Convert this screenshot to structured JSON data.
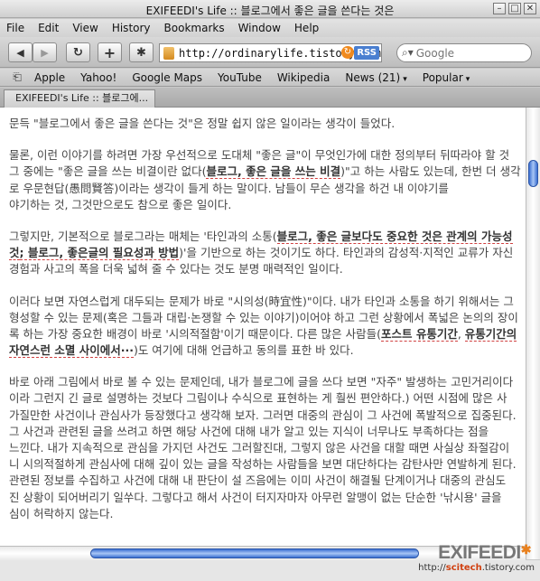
{
  "window": {
    "title": "EXIFEEDI's Life :: 블로그에서 좋은 글을 쓴다는 것은",
    "controls": [
      "–",
      "□",
      "✕"
    ]
  },
  "menu": [
    "File",
    "Edit",
    "View",
    "History",
    "Bookmarks",
    "Window",
    "Help"
  ],
  "toolbar": {
    "back_icon": "◀",
    "forward_icon": "▶",
    "reload_icon": "↻",
    "add_icon": "+",
    "bug_icon": "✱",
    "url": "http://ordinarylife.tistory.com",
    "rss_label": "RSS",
    "search_placeholder": "Google"
  },
  "bookmarks": {
    "book_icon": "⎗",
    "items": [
      "Apple",
      "Yahoo!",
      "Google Maps",
      "YouTube",
      "Wikipedia",
      "News (21)",
      "Popular"
    ],
    "chevron": "▾"
  },
  "tab": {
    "label": "EXIFEEDI's Life :: 블로그에..."
  },
  "article": {
    "p1": [
      "문득 \"블로그에서 좋은 글을 쓴다는 것\"은 정말 쉽지 않은 일이라는 생각이 들었다."
    ],
    "p2_l1": "물론, 이런 이야기를 하려면 가장 우선적으로 도대체 \"좋은 글\"이 무엇인가에 대한 정의부터 뒤따라야 할 것",
    "p2_l2a": "그 중에는 \"좋은 글을 쓰는 비결이란 없다(",
    "p2_l2u": "블로그, 좋은 글을 쓰는 비결",
    "p2_l2b": ")\"고 하는 사람도 있는데, 한번 더 생각",
    "p2_l3": "로 우문현답(愚問賢答)이라는 생각이 들게 하는 말이다. 남들이 무슨 생각을 하건 내 이야기를",
    "p2_l4": "야기하는 것, 그것만으로도 참으로 좋은 일이다.",
    "p3_l1a": "그렇지만, 기본적으로 블로그라는 매체는 '타인과의 소통(",
    "p3_l1u": "블로그, 좋은 글보다도 중요한 것은 관계의 가능성",
    "p3_l2a": "것",
    "p3_l2u": "; 블로그, 좋은글의 필요성과 방법",
    "p3_l2b": ")'을 기반으로 하는 것이기도 하다. 타인과의 감성적·지적인 교류가 자신",
    "p3_l3": "경험과 사고의 폭을 더욱 넓혀 줄 수 있다는 것도 분명 매력적인 일이다.",
    "p4_l1": "이러다 보면 자연스럽게 대두되는 문제가 바로 \"시의성(時宜性)\"이다. 내가 타인과 소통을 하기 위해서는 그",
    "p4_l2": "형성할 수 있는 문제(혹은 그들과 대립·논쟁할 수 있는 이야기)이어야 하고 그런 상황에서 폭넓은 논의의 장이",
    "p4_l3a": "록 하는 가장 중요한 배경이 바로 '시의적절함'이기 때문이다. 다른 많은 사람들(",
    "p4_l3u1": "포스트 유통기간",
    "p4_l3b": ", ",
    "p4_l3u2": "유통기간의",
    "p4_l4u": "자연스런 소멸 사이에서···",
    "p4_l4b": ")도 여기에 대해 언급하고 동의를 표한 바 있다.",
    "p5": [
      "바로 아래 그림에서 바로 볼 수 있는 문제인데, 내가 블로그에 글을 쓰다 보면 \"자주\" 발생하는 고민거리이다",
      "이라 그런지 긴 글로 설명하는 것보다 그림이나 수식으로 표현하는 게 훨씬 편안하다.) 어떤 시점에 많은 사",
      "가질만한 사건이나 관심사가 등장했다고 생각해 보자. 그러면 대중의 관심이 그 사건에 폭발적으로 집중된다.",
      "그 사건과 관련된 글을 쓰려고 하면 해당 사건에 대해 내가 알고 있는 지식이 너무나도 부족하다는 점을",
      "느낀다. 내가 지속적으로 관심을 가지던 사건도 그러할진대, 그렇지 않은 사건을 대할 때면 사실상 좌절감이",
      "니 시의적절하게 관심사에 대해 깊이 있는 글을 작성하는 사람들을 보면 대단하다는 감탄사만 연발하게 된다.",
      "관련된 정보를 수집하고 사건에 대해 내 판단이 설 즈음에는 이미 사건이 해결될 단계이거나 대중의 관심도",
      "진 상황이 되어버리기 일쑤다. 그렇다고 해서 사건이 터지자마자 아무런 알맹이 없는 단순한 '낚시용' 글을",
      "심이 허락하지 않는다."
    ]
  },
  "watermark": {
    "logo": "EXIFEEDI",
    "url_prefix": "http://",
    "url_bold": "scitech",
    "url_suffix": ".tistory.com"
  },
  "colors": {
    "accent": "#3b6fd1",
    "link_underline": "#d04040",
    "logo_star": "#e8801e"
  }
}
